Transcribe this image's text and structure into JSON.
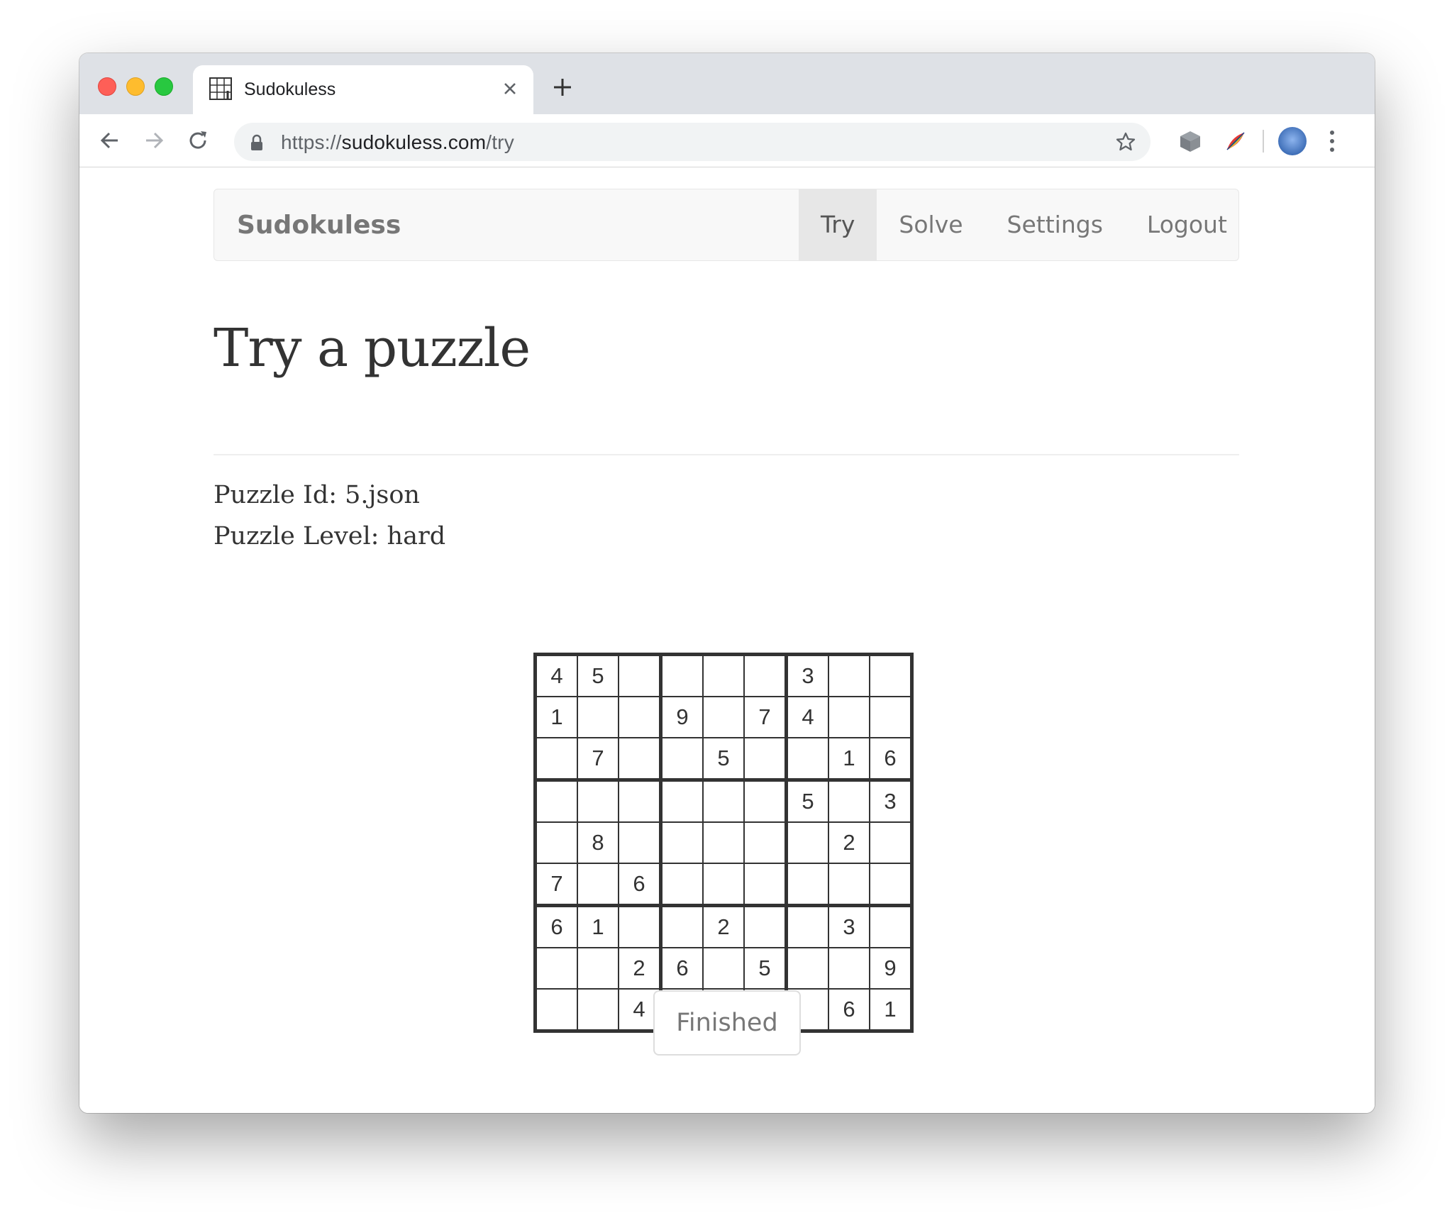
{
  "browser": {
    "tab_title": "Sudokuless",
    "url_scheme": "https://",
    "url_host": "sudokuless.com",
    "url_path": "/try"
  },
  "navbar": {
    "brand": "Sudokuless",
    "links": [
      {
        "label": "Try",
        "active": true
      },
      {
        "label": "Solve",
        "active": false
      },
      {
        "label": "Settings",
        "active": false
      },
      {
        "label": "Logout",
        "active": false
      }
    ]
  },
  "main": {
    "heading": "Try a puzzle",
    "puzzle_id": "Puzzle Id: 5.json",
    "puzzle_level": "Puzzle Level: hard",
    "finished_label": "Finished"
  },
  "sudoku": {
    "rows": [
      [
        "4",
        "5",
        "",
        "",
        "",
        "",
        "3",
        "",
        ""
      ],
      [
        "1",
        "",
        "",
        "9",
        "",
        "7",
        "4",
        "",
        ""
      ],
      [
        "",
        "7",
        "",
        "",
        "5",
        "",
        "",
        "1",
        "6"
      ],
      [
        "",
        "",
        "",
        "",
        "",
        "",
        "5",
        "",
        "3"
      ],
      [
        "",
        "8",
        "",
        "",
        "",
        "",
        "",
        "2",
        ""
      ],
      [
        "7",
        "",
        "6",
        "",
        "",
        "",
        "",
        "",
        ""
      ],
      [
        "6",
        "1",
        "",
        "",
        "2",
        "",
        "",
        "3",
        ""
      ],
      [
        "",
        "",
        "2",
        "6",
        "",
        "5",
        "",
        "",
        "9"
      ],
      [
        "",
        "",
        "4",
        "",
        "",
        "",
        "",
        "6",
        "1"
      ]
    ]
  }
}
